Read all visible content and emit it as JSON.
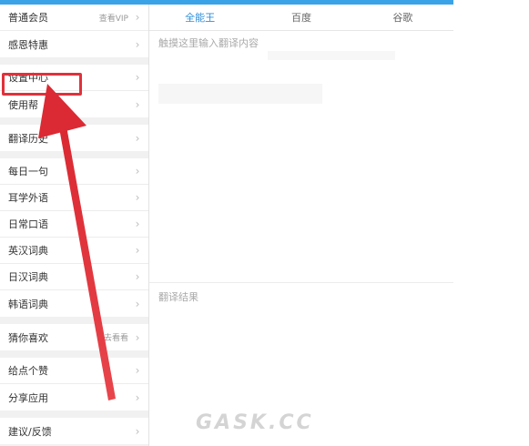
{
  "sidebar": {
    "groups": [
      {
        "items": [
          {
            "label": "普通会员",
            "extra": "查看VIP"
          },
          {
            "label": "感恩特惠",
            "extra": ""
          }
        ]
      },
      {
        "items": [
          {
            "label": "设置中心",
            "extra": ""
          },
          {
            "label": "使用帮",
            "extra": ""
          }
        ]
      },
      {
        "items": [
          {
            "label": "翻译历史",
            "extra": ""
          }
        ]
      },
      {
        "items": [
          {
            "label": "每日一句",
            "extra": ""
          },
          {
            "label": "耳学外语",
            "extra": ""
          },
          {
            "label": "日常口语",
            "extra": ""
          },
          {
            "label": "英汉词典",
            "extra": ""
          },
          {
            "label": "日汉词典",
            "extra": ""
          },
          {
            "label": "韩语词典",
            "extra": ""
          }
        ]
      },
      {
        "items": [
          {
            "label": "猜你喜欢",
            "extra": "去看看"
          }
        ]
      },
      {
        "items": [
          {
            "label": "给点个赞",
            "extra": ""
          },
          {
            "label": "分享应用",
            "extra": ""
          }
        ]
      },
      {
        "items": [
          {
            "label": "建议/反馈",
            "extra": ""
          }
        ]
      }
    ],
    "chevron": "›"
  },
  "main": {
    "tabs": [
      {
        "label": "全能王",
        "active": true
      },
      {
        "label": "百度",
        "active": false
      },
      {
        "label": "谷歌",
        "active": false
      }
    ],
    "input_placeholder": "触摸这里输入翻译内容",
    "result_label": "翻译结果"
  },
  "watermark": "GASK.CC",
  "colors": {
    "accent": "#2f8fd8",
    "highlight": "#e0313b",
    "topbar": "#3aa3e8"
  }
}
